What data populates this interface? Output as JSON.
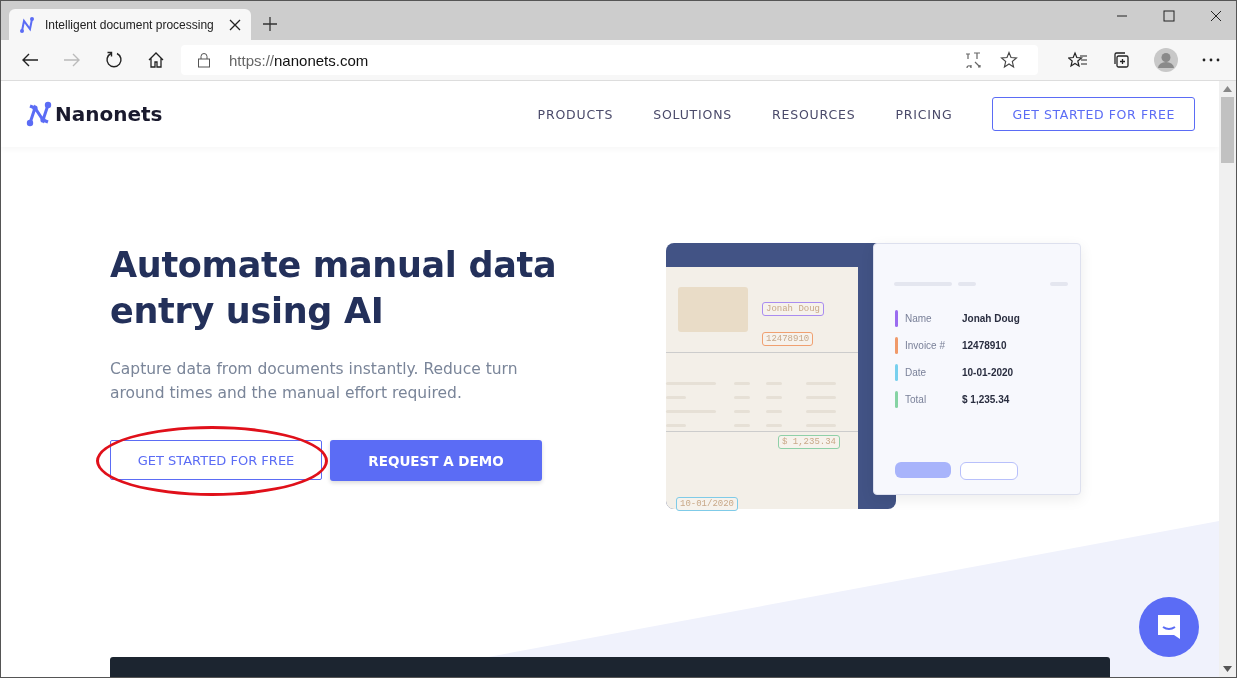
{
  "browser": {
    "tab_title": "Intelligent document processing",
    "url_scheme": "https://",
    "url_host": "nanonets.com"
  },
  "site": {
    "logo": "Nanonets",
    "nav": [
      "PRODUCTS",
      "SOLUTIONS",
      "RESOURCES",
      "PRICING"
    ],
    "nav_cta": "GET STARTED FOR FREE"
  },
  "hero": {
    "title": "Automate manual data entry using AI",
    "subtitle": "Capture data from documents instantly. Reduce turn around times and the manual effort required.",
    "primary_button": "GET STARTED FOR FREE",
    "secondary_button": "REQUEST A DEMO",
    "primary_highlighted": true
  },
  "illustration": {
    "doc_tags": [
      {
        "text": "Jonah Doug",
        "color": "#a98cf0"
      },
      {
        "text": "12478910",
        "color": "#f0a070"
      },
      {
        "text": "$ 1,235.34",
        "color": "#8fd0a8"
      },
      {
        "text": "10-01/2020",
        "color": "#7fcbe8"
      }
    ],
    "fields": [
      {
        "label": "Name",
        "value": "Jonah Doug",
        "color": "#9b6cf0"
      },
      {
        "label": "Invoice #",
        "value": "12478910",
        "color": "#f09a6a"
      },
      {
        "label": "Date",
        "value": "10-01-2020",
        "color": "#78d0ee"
      },
      {
        "label": "Total",
        "value": "$ 1,235.34",
        "color": "#86d3a4"
      }
    ]
  }
}
